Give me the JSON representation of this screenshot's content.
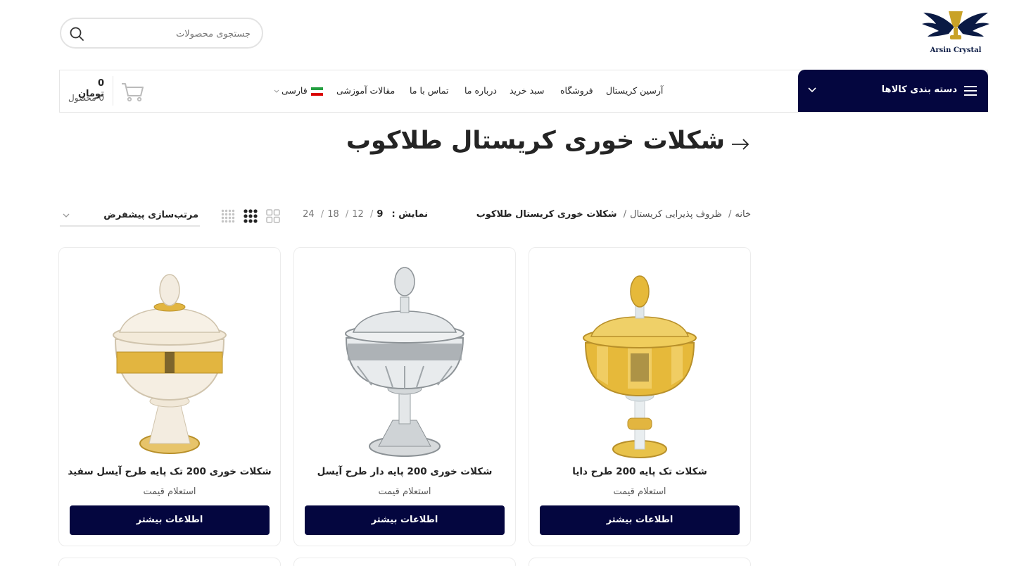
{
  "logo": {
    "text": "Arsin Crystal",
    "colors": {
      "navy": "#0a1a44",
      "gold": "#c9a227"
    }
  },
  "search": {
    "placeholder": "جستجوی محصولات",
    "value": ""
  },
  "categories": {
    "label": "دسته بندی کالاها"
  },
  "nav": {
    "items": [
      "آرسین کریستال",
      "فروشگاه",
      "سبد خرید",
      "درباره ما",
      "تماس با ما",
      "مقالات آموزشی"
    ],
    "language": "فارسی"
  },
  "cart": {
    "total": "0 تومان",
    "count": "0 محصول"
  },
  "page": {
    "title": "شکلات خوری کریستال طلاکوب"
  },
  "breadcrumb": [
    "خانه",
    "ظروف پذیرایی کریستال",
    "شکلات خوری کریستال طلاکوب"
  ],
  "per_page": {
    "label": "نمایش :",
    "options": [
      "9",
      "12",
      "18",
      "24"
    ],
    "active": "9"
  },
  "sort": {
    "selected": "مرتب‌سازی پیشفرض"
  },
  "colors": {
    "primary": "#04063f",
    "border": "#ececec"
  },
  "products": [
    {
      "title": "شکلات تک پایه 200 طرح دایا",
      "price": "استعلام قیمت",
      "button": "اطلاعات بیشتر"
    },
    {
      "title": "شکلات خوری 200 پایه دار طرح آیسل",
      "price": "استعلام قیمت",
      "button": "اطلاعات بیشتر"
    },
    {
      "title": "شکلات خوری 200 تک پایه طرح آیسل سفید",
      "price": "استعلام قیمت",
      "button": "اطلاعات بیشتر"
    }
  ]
}
